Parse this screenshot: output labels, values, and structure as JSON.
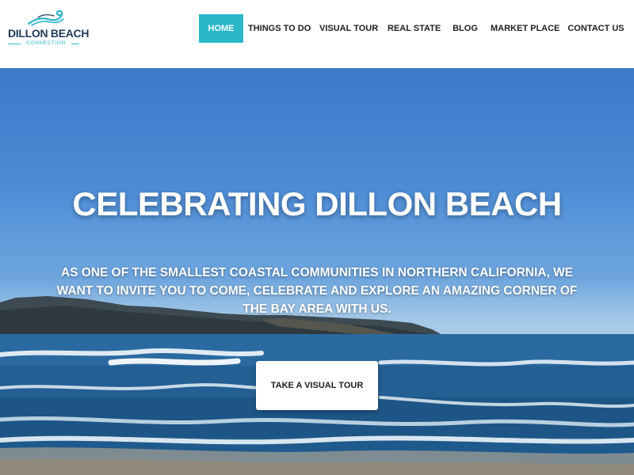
{
  "logo": {
    "title": "DILLON BEACH",
    "subtitle": "CONNECTION"
  },
  "nav": {
    "items": [
      {
        "label": "HOME",
        "active": true
      },
      {
        "label": "THINGS TO DO",
        "active": false
      },
      {
        "label": "VISUAL TOUR",
        "active": false
      },
      {
        "label": "REAL STATE",
        "active": false
      },
      {
        "label": "BLOG",
        "active": false
      },
      {
        "label": "MARKET PLACE",
        "active": false
      },
      {
        "label": "CONTACT US",
        "active": false
      }
    ]
  },
  "hero": {
    "title": "CELEBRATING DILLON BEACH",
    "text": "AS ONE OF THE SMALLEST COASTAL COMMUNITIES IN NORTHERN CALIFORNIA, WE WANT TO INVITE YOU TO COME, CELEBRATE AND EXPLORE AN AMAZING CORNER OF THE BAY AREA WITH US.",
    "button_label": "TAKE A VISUAL TOUR"
  },
  "colors": {
    "accent": "#2ab7c8",
    "logo_text": "#1f3b57",
    "sky": "#4e8dd6",
    "ocean": "#1f5a8c"
  }
}
